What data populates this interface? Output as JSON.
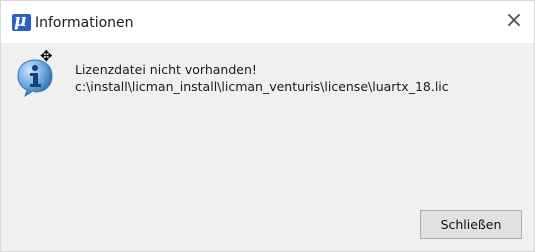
{
  "window": {
    "title": "Informationen",
    "app_icon_glyph": "μ",
    "close_glyph": "×"
  },
  "message": {
    "line1": "Lizenzdatei nicht vorhanden!",
    "line2": "c:\\install\\licman_install\\licman_venturis\\license\\luartx_18.lic",
    "icon": "info-icon"
  },
  "buttons": {
    "close_label": "Schließen"
  },
  "colors": {
    "accent": "#2a5fc4",
    "background": "#f0f0f0"
  }
}
